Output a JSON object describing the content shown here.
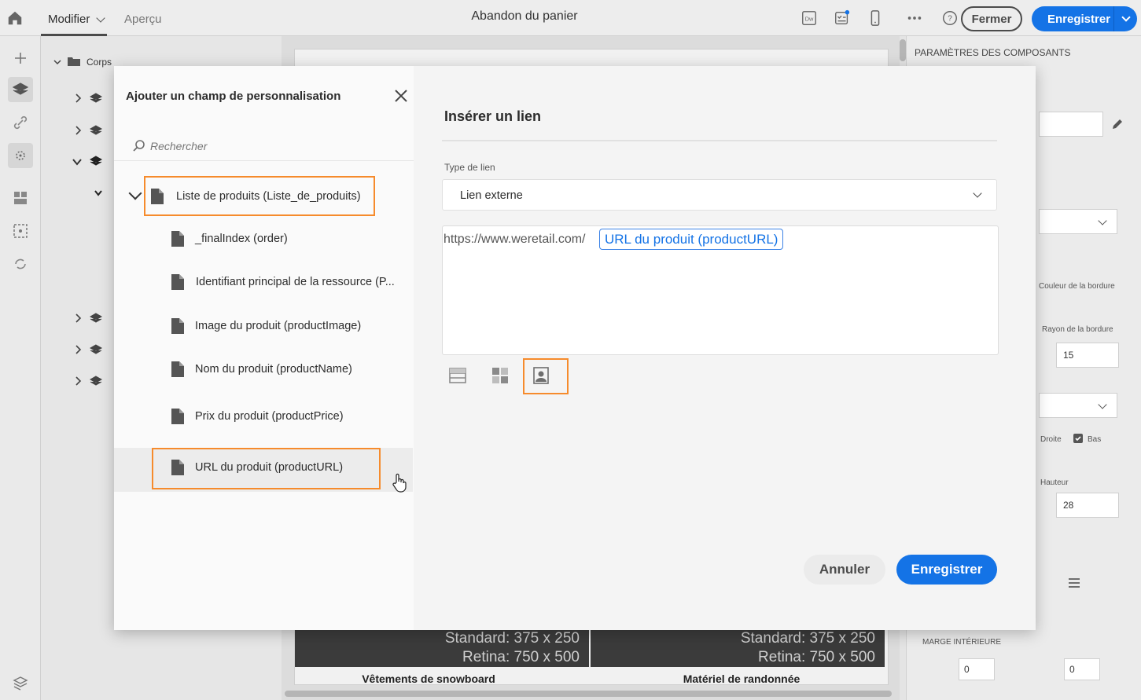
{
  "app": {
    "tabs": [
      {
        "label": "Modifier"
      },
      {
        "label": "Aperçu"
      }
    ],
    "document_title": "Abandon du panier",
    "toolbar": {
      "close_label": "Fermer",
      "save_label": "Enregistrer"
    }
  },
  "layers_panel": {
    "root_label": "Corps"
  },
  "canvas": {
    "image_blocks": [
      {
        "line1": "Standard: 375 x 250",
        "line2": "Retina: 750 x 500",
        "caption": "Vêtements de snowboard"
      },
      {
        "line1": "Standard: 375 x 250",
        "line2": "Retina: 750 x 500",
        "caption": "Matériel de randonnée"
      }
    ]
  },
  "properties_panel": {
    "heading": "PARAMÈTRES DES COMPOSANTS",
    "labels": {
      "border_color": "Couleur de la bordure",
      "border_radius": "Rayon de la bordure",
      "right": "Droite",
      "bottom": "Bas",
      "height": "Hauteur",
      "padding": "MARGE INTÉRIEURE"
    },
    "values": {
      "border_radius": "15",
      "height": "28",
      "padding_a": "0",
      "padding_b": "0"
    }
  },
  "personalization_dialog": {
    "title": "Ajouter un champ de personnalisation",
    "search_placeholder": "Rechercher",
    "tree": {
      "parent_label": "Liste de produits (Liste_de_produits)",
      "children": [
        {
          "label": "_finalIndex (order)"
        },
        {
          "label": "Identifiant principal de la ressource (P..."
        },
        {
          "label": "Image du produit (productImage)"
        },
        {
          "label": "Nom du produit (productName)"
        },
        {
          "label": "Prix du produit (productPrice)"
        },
        {
          "label": "URL du produit (productURL)"
        }
      ]
    }
  },
  "link_dialog": {
    "title": "Insérer un lien",
    "link_type_label": "Type de lien",
    "link_type_value": "Lien externe",
    "url_prefix": "https://www.weretail.com/",
    "url_token": "URL du produit (productURL)",
    "cancel_label": "Annuler",
    "save_label": "Enregistrer"
  },
  "colors": {
    "accent": "#1473e6",
    "highlight": "#f68b2c"
  }
}
